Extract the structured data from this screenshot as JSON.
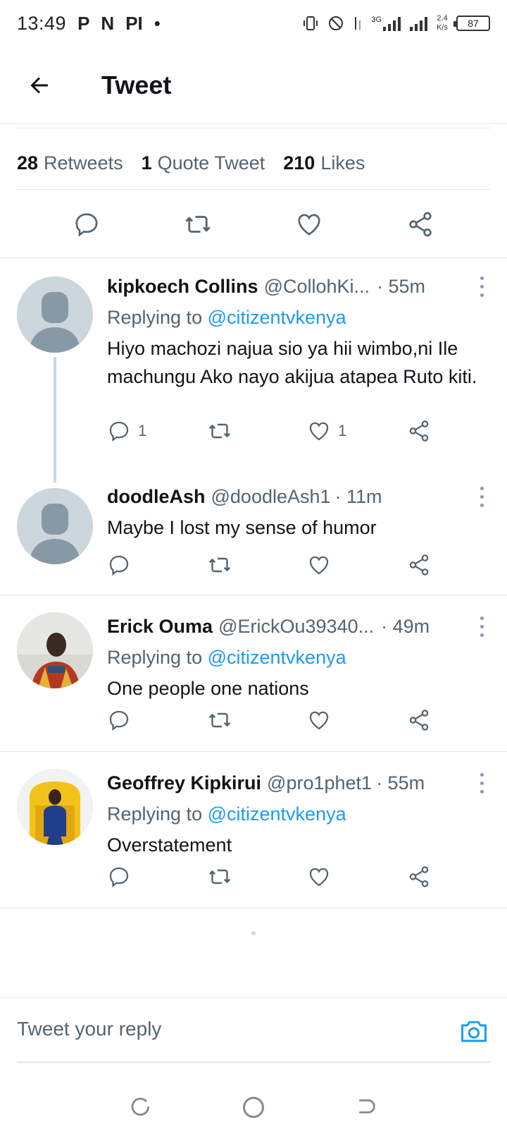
{
  "status_bar": {
    "time": "13:49",
    "notif_glyphs": [
      "P",
      "N",
      "PI",
      "•"
    ],
    "network": "3G",
    "speed_value": "2.4",
    "speed_unit": "K/s",
    "battery": "87"
  },
  "header": {
    "title": "Tweet"
  },
  "stats": {
    "retweets_count": "28",
    "retweets_label": "Retweets",
    "quotes_count": "1",
    "quotes_label": "Quote Tweet",
    "likes_count": "210",
    "likes_label": "Likes"
  },
  "replies": [
    {
      "name": "kipkoech Collins",
      "handle": "@CollohKi...",
      "time": "· 55m",
      "replying_prefix": "Replying to",
      "replying_to": "@citizentvkenya",
      "text": "Hiyo machozi najua sio ya hii wimbo,ni Ile machungu Ako nayo akijua atapea Ruto kiti.",
      "reply_count": "1",
      "like_count": "1"
    },
    {
      "name": "doodleAsh",
      "handle": "@doodleAsh1",
      "time": "· 11m",
      "text": "Maybe I lost my sense of humor"
    },
    {
      "name": "Erick Ouma",
      "handle": "@ErickOu39340...",
      "time": "· 49m",
      "replying_prefix": "Replying to",
      "replying_to": "@citizentvkenya",
      "text": "One people one nations"
    },
    {
      "name": "Geoffrey Kipkirui",
      "handle": "@pro1phet1",
      "time": "· 55m",
      "replying_prefix": "Replying to",
      "replying_to": "@citizentvkenya",
      "text": "Overstatement"
    }
  ],
  "reply_bar": {
    "placeholder": "Tweet your reply"
  },
  "colors": {
    "accent": "#1d9bf0",
    "muted": "#536471",
    "text": "#0f1419",
    "divider": "#e6e6e6"
  }
}
